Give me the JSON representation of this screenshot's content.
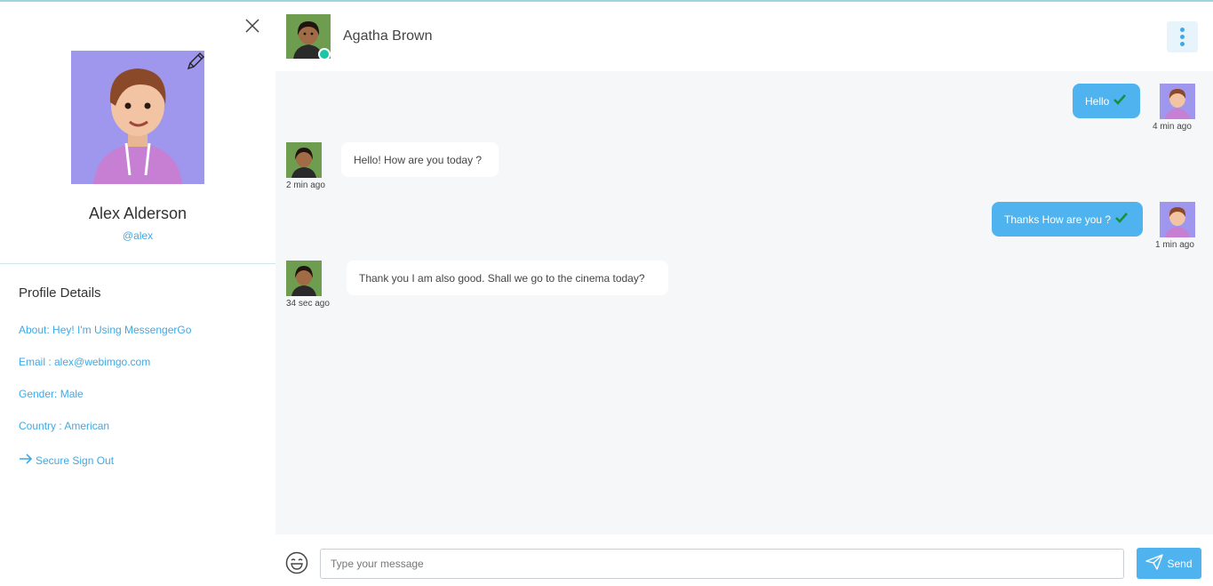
{
  "sidebar": {
    "profile": {
      "name": "Alex Alderson",
      "handle": "@alex"
    },
    "details_title": "Profile Details",
    "details": [
      {
        "text": "About: Hey! I'm Using MessengerGo"
      },
      {
        "text": "Email : alex@webimgo.com"
      },
      {
        "text": "Gender: Male"
      },
      {
        "text": "Country : American"
      }
    ],
    "signout_label": "Secure Sign Out"
  },
  "chat_header": {
    "contact_name": "Agatha Brown",
    "status": "online"
  },
  "messages": [
    {
      "direction": "out",
      "text": "Hello",
      "time": "4 min ago",
      "read": true
    },
    {
      "direction": "in",
      "text": "Hello! How are you today ?",
      "time": "2 min ago"
    },
    {
      "direction": "out",
      "text": "Thanks How are you ?",
      "time": "1 min ago",
      "read": true
    },
    {
      "direction": "in",
      "text": "Thank you I am also good. Shall we go to the cinema today?",
      "time": "34 sec ago"
    }
  ],
  "composer": {
    "placeholder": "Type your message",
    "value": "",
    "send_label": "Send"
  },
  "colors": {
    "accent": "#4fb3f0",
    "link": "#3fa9e6",
    "online": "#19c6a5",
    "chat_background": "#f5f7f9",
    "read_check": "#1a8f3a"
  },
  "icons": {
    "close": "close-icon",
    "edit": "pencil-icon",
    "more": "more-vertical-icon",
    "signout": "arrow-right-icon",
    "emoji": "emoji-icon",
    "send": "send-icon",
    "read": "check-icon"
  }
}
